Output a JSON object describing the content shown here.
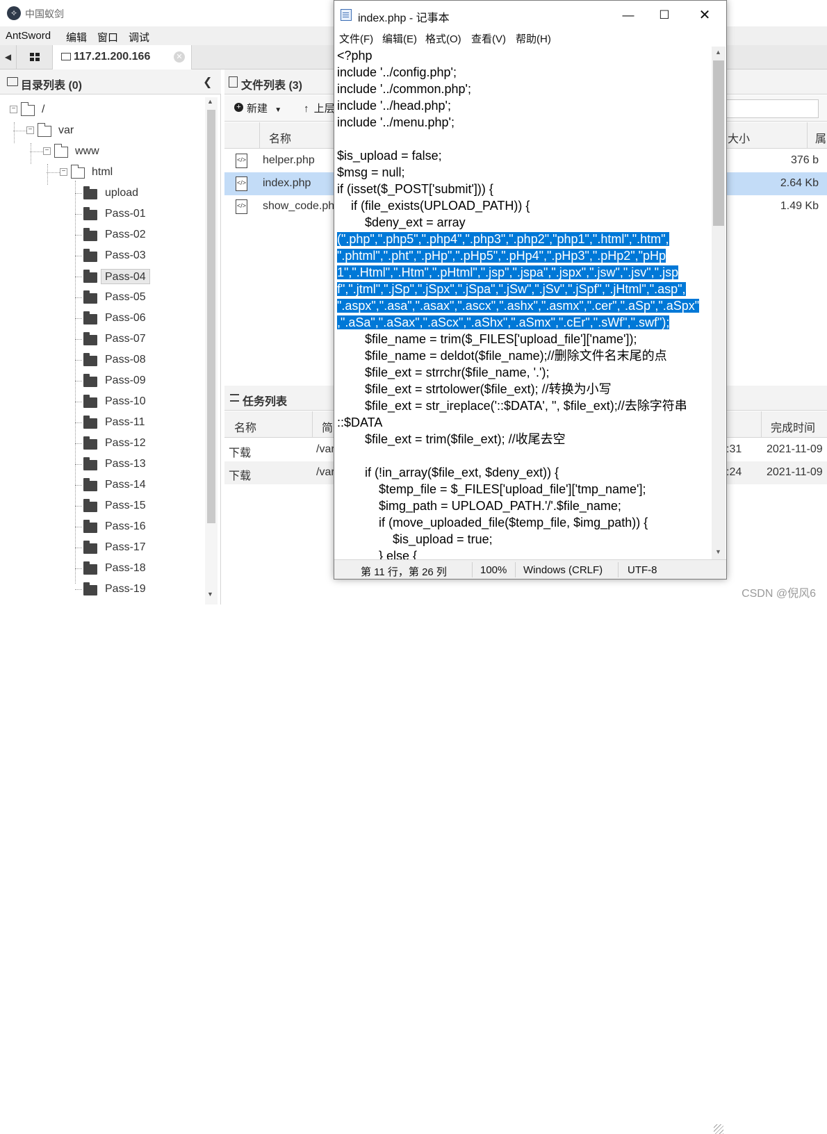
{
  "antsword": {
    "title": "中国蚁剑",
    "menu": [
      "AntSword",
      "编辑",
      "窗口",
      "调试"
    ],
    "tab_host": "117.21.200.166",
    "dir_panel": {
      "title": "目录列表 (0)",
      "tree": [
        {
          "label": "/",
          "type": "open"
        },
        {
          "label": "var",
          "type": "open"
        },
        {
          "label": "www",
          "type": "open"
        },
        {
          "label": "html",
          "type": "open"
        },
        {
          "label": "upload",
          "type": "closed"
        },
        {
          "label": "Pass-01",
          "type": "closed"
        },
        {
          "label": "Pass-02",
          "type": "closed"
        },
        {
          "label": "Pass-03",
          "type": "closed"
        },
        {
          "label": "Pass-04",
          "type": "closed",
          "selected": true
        },
        {
          "label": "Pass-05",
          "type": "closed"
        },
        {
          "label": "Pass-06",
          "type": "closed"
        },
        {
          "label": "Pass-07",
          "type": "closed"
        },
        {
          "label": "Pass-08",
          "type": "closed"
        },
        {
          "label": "Pass-09",
          "type": "closed"
        },
        {
          "label": "Pass-10",
          "type": "closed"
        },
        {
          "label": "Pass-11",
          "type": "closed"
        },
        {
          "label": "Pass-12",
          "type": "closed"
        },
        {
          "label": "Pass-13",
          "type": "closed"
        },
        {
          "label": "Pass-14",
          "type": "closed"
        },
        {
          "label": "Pass-15",
          "type": "closed"
        },
        {
          "label": "Pass-16",
          "type": "closed"
        },
        {
          "label": "Pass-17",
          "type": "closed"
        },
        {
          "label": "Pass-18",
          "type": "closed"
        },
        {
          "label": "Pass-19",
          "type": "closed"
        }
      ]
    },
    "file_panel": {
      "title": "文件列表 (3)",
      "new_label": "新建",
      "up_label": "上层",
      "columns": {
        "name": "名称",
        "size": "大小",
        "attr": "属"
      },
      "files": [
        {
          "name": "helper.php",
          "size": "376 b",
          "selected": false
        },
        {
          "name": "index.php",
          "size": "2.64 Kb",
          "selected": true
        },
        {
          "name": "show_code.php",
          "size": "1.49 Kb",
          "selected": false
        }
      ]
    },
    "task_panel": {
      "title": "任务列表",
      "columns": {
        "name": "名称",
        "brief": "简",
        "done": "完成时间"
      },
      "rows": [
        {
          "name": "下载",
          "path": "/var",
          "time_tail": ":31",
          "done": "2021-11-09"
        },
        {
          "name": "下载",
          "path": "/var",
          "time_tail": ":24",
          "done": "2021-11-09"
        }
      ]
    },
    "watermark": "CSDN @倪风6"
  },
  "notepad": {
    "title": "index.php - 记事本",
    "menu": [
      "文件(F)",
      "编辑(E)",
      "格式(O)",
      "查看(V)",
      "帮助(H)"
    ],
    "lines": [
      {
        "text": "<?php"
      },
      {
        "text": "include '../config.php';"
      },
      {
        "text": "include '../common.php';"
      },
      {
        "text": "include '../head.php';"
      },
      {
        "text": "include '../menu.php';"
      },
      {
        "text": ""
      },
      {
        "text": "$is_upload = false;"
      },
      {
        "text": "$msg = null;"
      },
      {
        "text": "if (isset($_POST['submit'])) {"
      },
      {
        "text": "    if (file_exists(UPLOAD_PATH)) {"
      },
      {
        "text": "        $deny_ext = array"
      },
      {
        "hl": "(\".php\",\".php5\",\".php4\",\".php3\",\".php2\",\"php1\",\".html\",\".htm\","
      },
      {
        "hl": "\".phtml\",\".pht\",\".pHp\",\".pHp5\",\".pHp4\",\".pHp3\",\".pHp2\",\"pHp"
      },
      {
        "hl": "1\",\".Html\",\".Htm\",\".pHtml\",\".jsp\",\".jspa\",\".jspx\",\".jsw\",\".jsv\",\".jsp"
      },
      {
        "hl": "f\",\".jtml\",\".jSp\",\".jSpx\",\".jSpa\",\".jSw\",\".jSv\",\".jSpf\",\".jHtml\",\".asp\","
      },
      {
        "hl": "\".aspx\",\".asa\",\".asax\",\".ascx\",\".ashx\",\".asmx\",\".cer\",\".aSp\",\".aSpx\""
      },
      {
        "hl": ",\".aSa\",\".aSax\",\".aScx\",\".aShx\",\".aSmx\",\".cEr\",\".sWf\",\".swf\");"
      },
      {
        "text": "        $file_name = trim($_FILES['upload_file']['name']);"
      },
      {
        "text": "        $file_name = deldot($file_name);//删除文件名末尾的点"
      },
      {
        "text": "        $file_ext = strrchr($file_name, '.');"
      },
      {
        "text": "        $file_ext = strtolower($file_ext); //转换为小写"
      },
      {
        "text": "        $file_ext = str_ireplace('::$DATA', '', $file_ext);//去除字符串"
      },
      {
        "text": "::$DATA"
      },
      {
        "text": "        $file_ext = trim($file_ext); //收尾去空"
      },
      {
        "text": ""
      },
      {
        "text": "        if (!in_array($file_ext, $deny_ext)) {"
      },
      {
        "text": "            $temp_file = $_FILES['upload_file']['tmp_name'];"
      },
      {
        "text": "            $img_path = UPLOAD_PATH.'/'.$file_name;"
      },
      {
        "text": "            if (move_uploaded_file($temp_file, $img_path)) {"
      },
      {
        "text": "                $is_upload = true;"
      },
      {
        "text": "            } else {"
      }
    ],
    "status": {
      "position": "第 11 行，第 26 列",
      "zoom": "100%",
      "eol": "Windows (CRLF)",
      "encoding": "UTF-8"
    }
  }
}
